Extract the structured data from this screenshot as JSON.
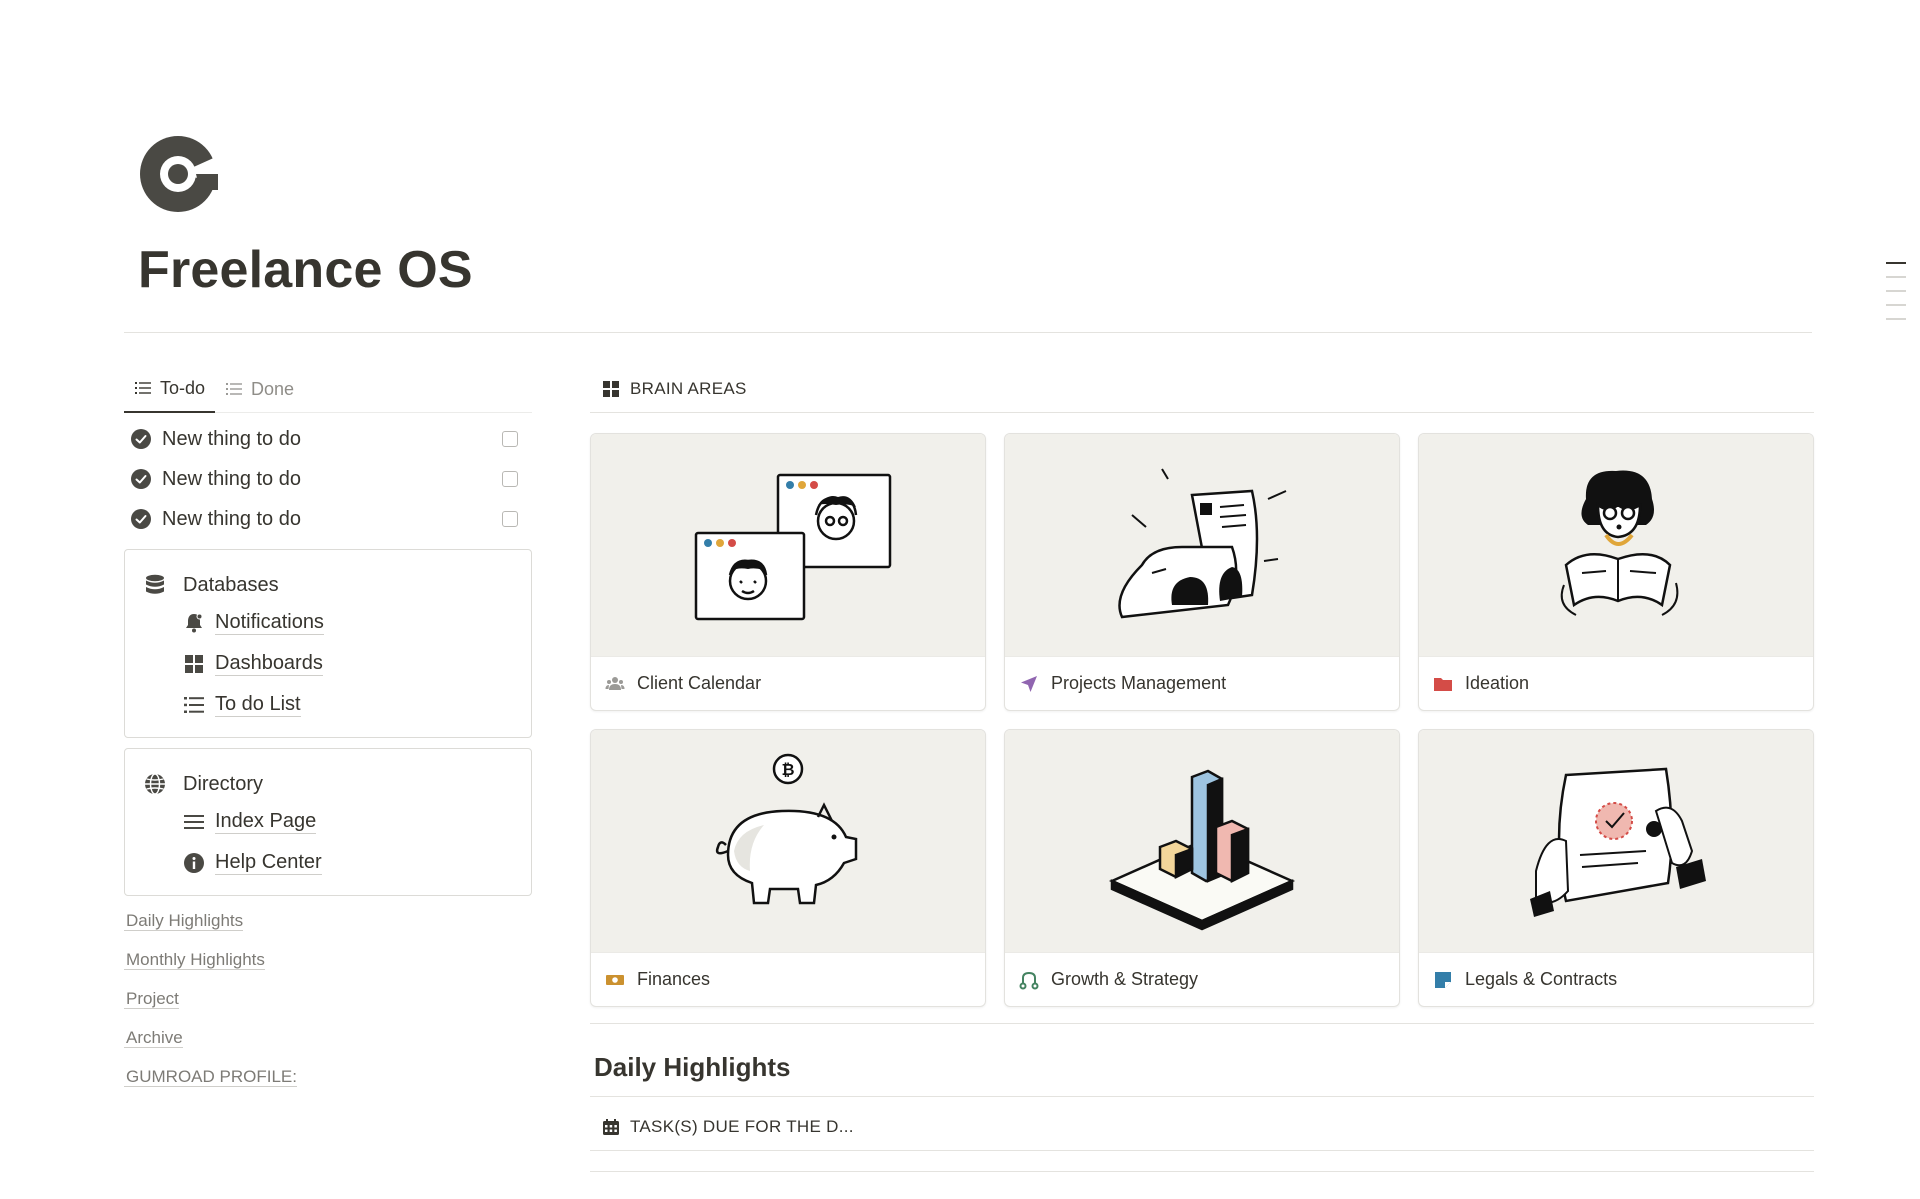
{
  "page": {
    "title": "Freelance OS",
    "icon": "freelance-os-logo-icon"
  },
  "todo_tabs": [
    {
      "label": "To-do",
      "icon": "list-icon",
      "active": true
    },
    {
      "label": "Done",
      "icon": "list-icon",
      "active": false
    }
  ],
  "todos": [
    {
      "label": "New thing to do",
      "checked": false
    },
    {
      "label": "New thing to do",
      "checked": false
    },
    {
      "label": "New thing to do",
      "checked": false
    }
  ],
  "databases": {
    "title": "Databases",
    "icon": "database-icon",
    "links": [
      {
        "label": "Notifications",
        "icon": "bell-icon"
      },
      {
        "label": "Dashboards",
        "icon": "grid-icon"
      },
      {
        "label": "To do List",
        "icon": "bullet-list-icon"
      }
    ]
  },
  "directory": {
    "title": "Directory",
    "icon": "globe-icon",
    "links": [
      {
        "label": "Index Page",
        "icon": "menu-lines-icon"
      },
      {
        "label": "Help Center",
        "icon": "info-icon"
      }
    ]
  },
  "plain_links": [
    "Daily Highlights",
    "Monthly Highlights",
    "Project",
    "Archive",
    "GUMROAD PROFILE:"
  ],
  "brain_areas": {
    "heading": "BRAIN AREAS",
    "heading_icon": "grid-icon",
    "cards": [
      {
        "label": "Client Calendar",
        "icon": "people-icon",
        "icon_color": "#9b9a97",
        "illustration": "two-portrait-windows"
      },
      {
        "label": "Projects Management",
        "icon": "navigation-arrow-icon",
        "icon_color": "#9065b0",
        "illustration": "rolling-papers"
      },
      {
        "label": "Ideation",
        "icon": "folder-icon",
        "icon_color": "#d44c47",
        "illustration": "reading-person"
      },
      {
        "label": "Finances",
        "icon": "banknote-icon",
        "icon_color": "#cb912f",
        "illustration": "piggy-bank-coin"
      },
      {
        "label": "Growth & Strategy",
        "icon": "route-icon",
        "icon_color": "#448361",
        "illustration": "bar-blocks-platform"
      },
      {
        "label": "Legals & Contracts",
        "icon": "note-icon",
        "icon_color": "#337ea9",
        "illustration": "hands-holding-contract"
      }
    ]
  },
  "daily": {
    "heading": "Daily Highlights",
    "sub_heading": "TASK(S) DUE FOR THE D...",
    "sub_icon": "calendar-icon"
  }
}
